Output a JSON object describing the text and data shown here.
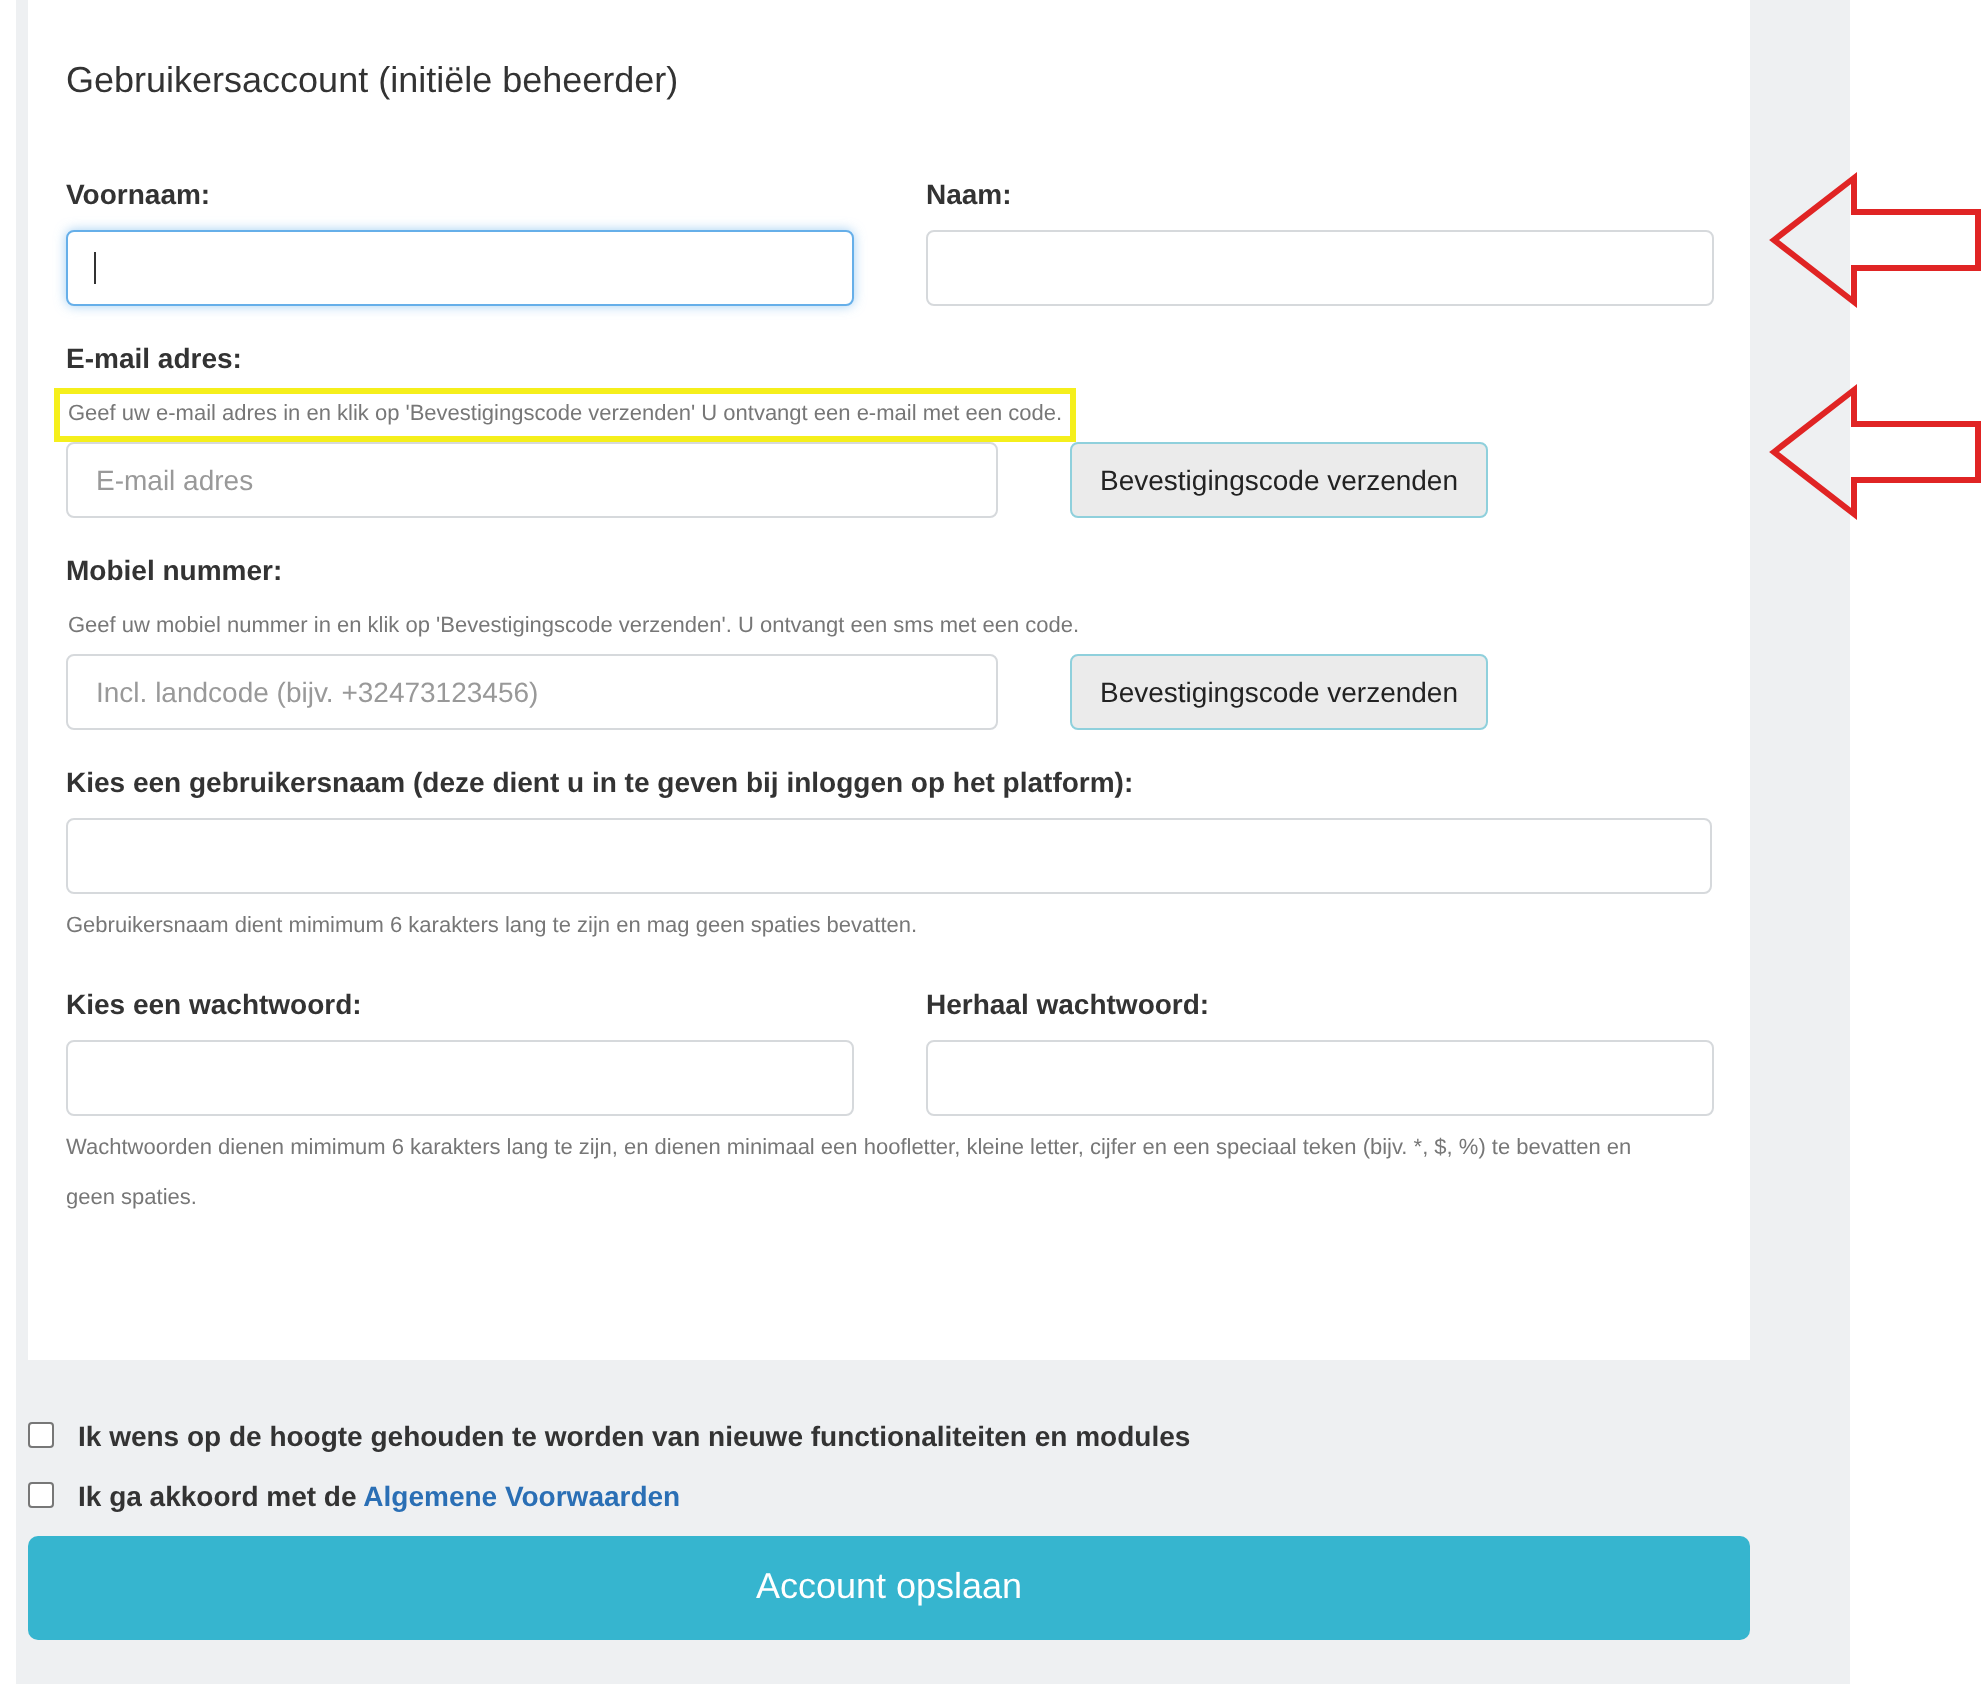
{
  "section": {
    "title": "Gebruikersaccount (initiële beheerder)"
  },
  "rows": [
    {
      "kind": "pair",
      "arrow": true,
      "fields": [
        {
          "label": "Voornaam:",
          "focused": true
        },
        {
          "label": "Naam:",
          "focused": false
        }
      ]
    },
    {
      "kind": "verify",
      "arrow": true,
      "label": "E-mail adres:",
      "hint": "Geef uw e-mail adres in en klik op 'Bevestigingscode verzenden' U ontvangt een e-mail met een code.",
      "highlighted": true,
      "placeholder": "E-mail adres",
      "button": "Bevestigingscode verzenden"
    },
    {
      "kind": "verify",
      "arrow": false,
      "label": "Mobiel nummer:",
      "hint": "Geef uw mobiel nummer in en klik op 'Bevestigingscode verzenden'. U ontvangt een sms met een code.",
      "highlighted": false,
      "placeholder": "Incl. landcode (bijv. +32473123456)",
      "button": "Bevestigingscode verzenden"
    },
    {
      "kind": "single",
      "arrow": false,
      "label": "Kies een gebruikersnaam (deze dient u in te geven bij inloggen op het platform):",
      "note": "Gebruikersnaam dient mimimum 6 karakters lang te zijn en mag geen spaties bevatten."
    },
    {
      "kind": "pair",
      "arrow": false,
      "fields": [
        {
          "label": "Kies een wachtwoord:",
          "focused": false
        },
        {
          "label": "Herhaal wachtwoord:",
          "focused": false
        }
      ],
      "note": "Wachtwoorden dienen mimimum 6 karakters lang te zijn, en dienen minimaal een hoofletter, kleine letter, cijfer en een speciaal teken (bijv. *, $, %) te bevatten en geen spaties."
    }
  ],
  "checkboxes": [
    {
      "text": "Ik wens op de hoogte gehouden te worden van nieuwe functionaliteiten en modules",
      "checked": false
    },
    {
      "text": "Ik ga akkoord met de",
      "link": "Algemene Voorwaarden",
      "checked": false
    }
  ],
  "submit": "Account opslaan"
}
